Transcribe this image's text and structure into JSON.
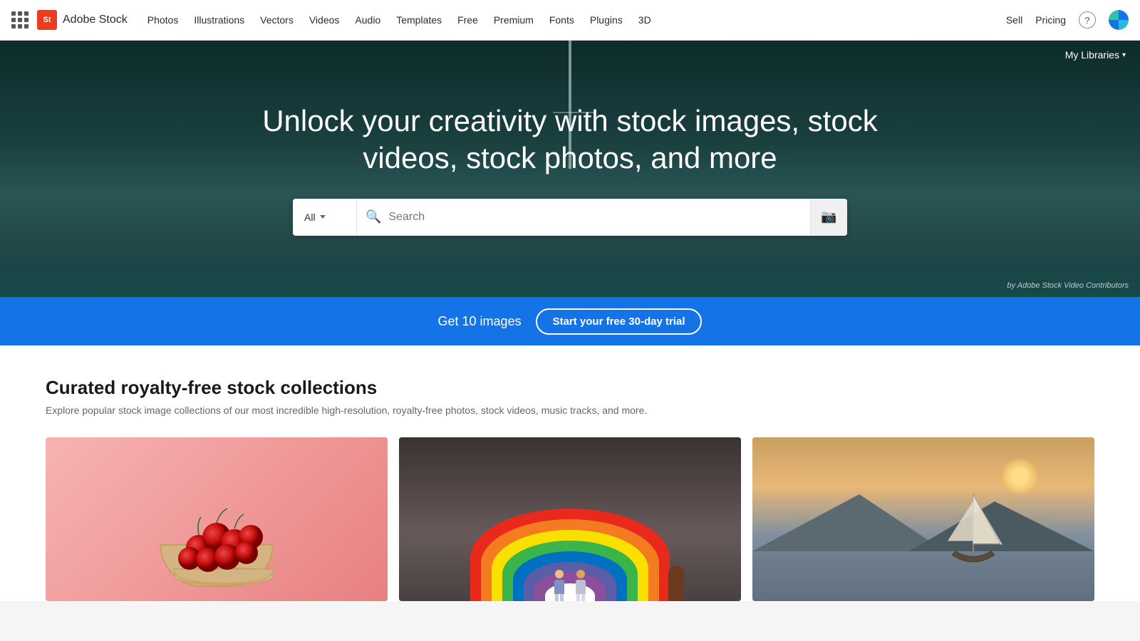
{
  "navbar": {
    "logo_text": "Adobe Stock",
    "logo_badge": "St",
    "nav_items": [
      {
        "label": "Photos",
        "id": "photos"
      },
      {
        "label": "Illustrations",
        "id": "illustrations"
      },
      {
        "label": "Vectors",
        "id": "vectors"
      },
      {
        "label": "Videos",
        "id": "videos"
      },
      {
        "label": "Audio",
        "id": "audio"
      },
      {
        "label": "Templates",
        "id": "templates"
      },
      {
        "label": "Free",
        "id": "free"
      },
      {
        "label": "Premium",
        "id": "premium"
      },
      {
        "label": "Fonts",
        "id": "fonts"
      },
      {
        "label": "Plugins",
        "id": "plugins"
      },
      {
        "label": "3D",
        "id": "3d"
      }
    ],
    "sell_label": "Sell",
    "pricing_label": "Pricing",
    "help_icon": "?",
    "my_libraries_label": "My Libraries"
  },
  "hero": {
    "title": "Unlock your creativity with stock images, stock videos, stock photos, and more",
    "search_placeholder": "Search",
    "search_category": "All",
    "attribution": "by Adobe Stock Video Contributors"
  },
  "promo": {
    "text": "Get 10 images",
    "button_label": "Start your free 30-day trial"
  },
  "collections": {
    "title": "Curated royalty-free stock collections",
    "subtitle": "Explore popular stock image collections of our most incredible high-resolution, royalty-free photos, stock videos, music tracks, and more."
  }
}
